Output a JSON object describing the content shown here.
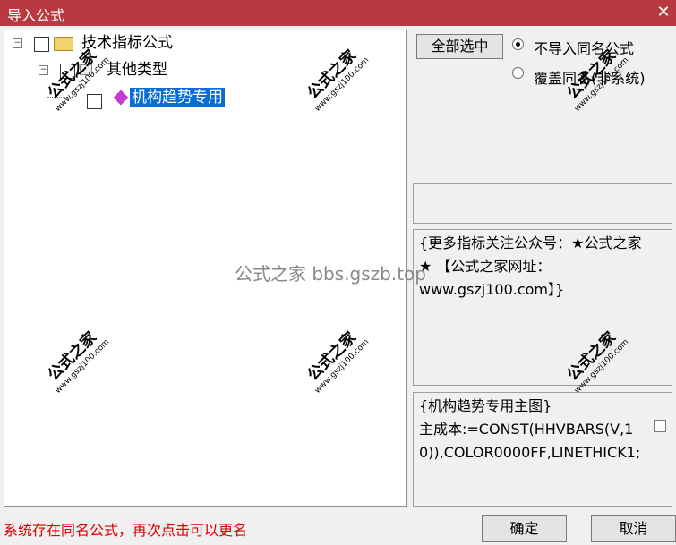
{
  "window": {
    "title": "导入公式",
    "close_symbol": "✕"
  },
  "tree": {
    "root": {
      "label": "技术指标公式",
      "expander": "−"
    },
    "group": {
      "label": "其他类型",
      "expander": "−"
    },
    "item": {
      "label": "机构趋势专用",
      "selected": true
    }
  },
  "options": {
    "select_all_label": "全部选中",
    "radio_no_import": "不导入同名公式",
    "radio_overwrite": "覆盖同名(非系统)",
    "selected_radio": "radio_no_import"
  },
  "description": "{更多指标关注公众号：★公式之家★ 【公式之家网址：www.gszj100.com】}",
  "source_code": "{机构趋势专用主图}\n主成本:=CONST(HHVBARS(V,10)),COLOR0000FF,LINETHICK1;",
  "status_message": "系统存在同名公式，再次点击可以更名",
  "buttons": {
    "ok": "确定",
    "cancel": "取消"
  },
  "watermark": "公式之家 bbs.gszb.top",
  "stamp": {
    "title": "公式之家",
    "url": "www.gszj100.com"
  }
}
